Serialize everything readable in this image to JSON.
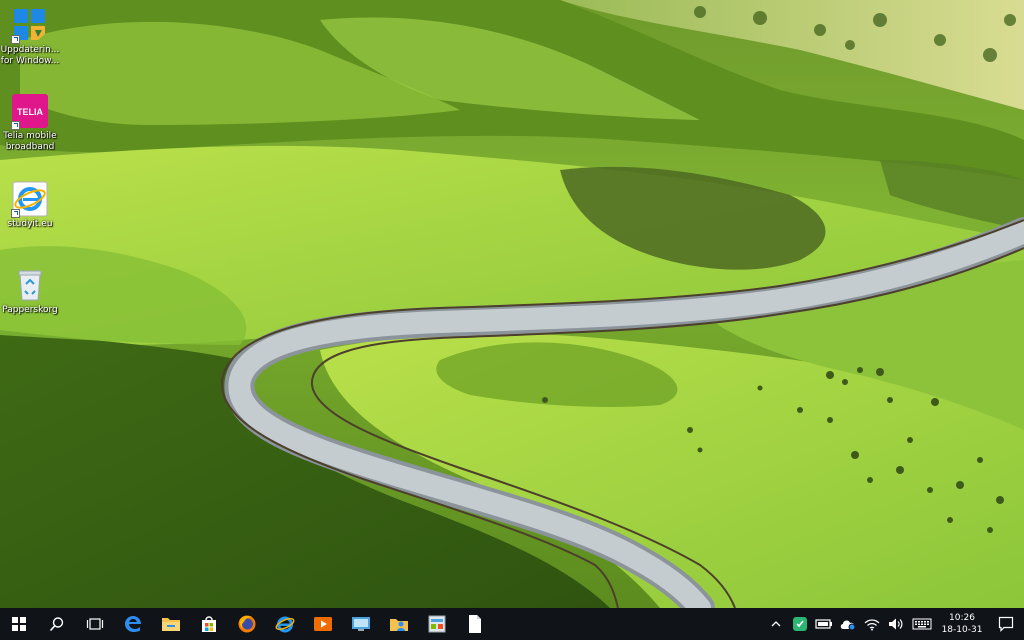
{
  "desktop": {
    "icons": [
      {
        "label": "Uppdaterin...\nfor Window...",
        "icon": "windows-update-icon"
      },
      {
        "label": "Telia mobile\nbroadband",
        "icon": "telia-icon",
        "badge": "TELIA"
      },
      {
        "label": "studyit.eu",
        "icon": "internet-explorer-icon"
      },
      {
        "label": "Papperskorg",
        "icon": "recycle-bin-icon"
      }
    ]
  },
  "taskbar": {
    "pinned": [
      {
        "name": "start",
        "icon": "windows-logo-icon"
      },
      {
        "name": "search",
        "icon": "search-icon"
      },
      {
        "name": "task-view",
        "icon": "task-view-icon"
      },
      {
        "name": "edge",
        "icon": "edge-icon"
      },
      {
        "name": "file-explorer",
        "icon": "folder-icon"
      },
      {
        "name": "store",
        "icon": "store-icon"
      },
      {
        "name": "firefox",
        "icon": "firefox-icon"
      },
      {
        "name": "internet-explorer",
        "icon": "internet-explorer-icon"
      },
      {
        "name": "media-player",
        "icon": "media-player-icon"
      },
      {
        "name": "remote-desktop",
        "icon": "remote-desktop-icon"
      },
      {
        "name": "file-manager",
        "icon": "user-folder-icon"
      },
      {
        "name": "control-panel",
        "icon": "control-panel-icon"
      },
      {
        "name": "notepad",
        "icon": "document-icon"
      }
    ],
    "tray": [
      {
        "name": "show-hidden",
        "icon": "chevron-up-icon"
      },
      {
        "name": "app-tray",
        "icon": "green-app-icon"
      },
      {
        "name": "battery",
        "icon": "battery-icon"
      },
      {
        "name": "onedrive",
        "icon": "cloud-icon"
      },
      {
        "name": "wifi",
        "icon": "wifi-icon"
      },
      {
        "name": "volume",
        "icon": "speaker-icon"
      },
      {
        "name": "keyboard",
        "icon": "keyboard-icon"
      }
    ],
    "clock": {
      "time": "10:26",
      "date": "18-10-31"
    }
  },
  "colors": {
    "taskbar_bg": "#101318",
    "sky_green": "#8cc63a",
    "telia_pink": "#e0168b",
    "windows_blue": "#1e88e5"
  }
}
